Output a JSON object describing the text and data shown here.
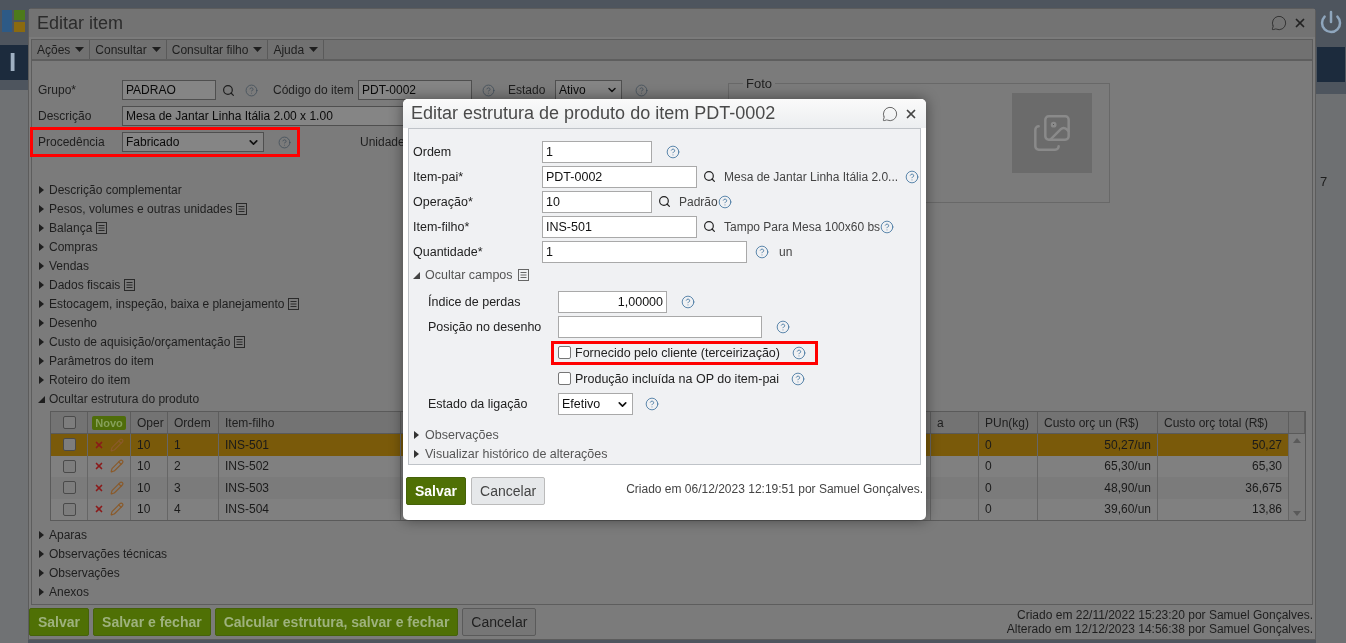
{
  "app_sidebar": {
    "title_fragment": "I"
  },
  "right_strip": {
    "count_fragment": "7"
  },
  "window": {
    "title": "Editar item"
  },
  "menu": [
    {
      "label": "Ações"
    },
    {
      "label": "Consultar"
    },
    {
      "label": "Consultar filho"
    },
    {
      "label": "Ajuda"
    }
  ],
  "form": {
    "grupo": {
      "label": "Grupo*",
      "value": "PADRAO"
    },
    "codigo": {
      "label": "Código do item",
      "value": "PDT-0002"
    },
    "estado": {
      "label": "Estado",
      "value": "Ativo"
    },
    "descricao": {
      "label": "Descrição",
      "value": "Mesa de Jantar Linha Itália 2.00 x 1.00"
    },
    "procedencia": {
      "label": "Procedência",
      "value": "Fabricado",
      "highlighted": true
    },
    "unidade": {
      "label": "Unidade"
    }
  },
  "foto": {
    "legend": "Foto"
  },
  "sections": [
    {
      "label": "Descrição complementar",
      "expanded": false,
      "note": false
    },
    {
      "label": "Pesos, volumes e outras unidades",
      "expanded": false,
      "note": true
    },
    {
      "label": "Balança",
      "expanded": false,
      "note": true
    },
    {
      "label": "Compras",
      "expanded": false,
      "note": false
    },
    {
      "label": "Vendas",
      "expanded": false,
      "note": false
    },
    {
      "label": "Dados fiscais",
      "expanded": false,
      "note": true
    },
    {
      "label": "Estocagem, inspeção, baixa e planejamento",
      "expanded": false,
      "note": true
    },
    {
      "label": "Desenho",
      "expanded": false,
      "note": false
    },
    {
      "label": "Custo de aquisição/orçamentação",
      "expanded": false,
      "note": true
    },
    {
      "label": "Parâmetros do item",
      "expanded": false,
      "note": false
    },
    {
      "label": "Roteiro do item",
      "expanded": false,
      "note": false
    },
    {
      "label": "Ocultar estrutura do produto",
      "expanded": true,
      "note": false
    }
  ],
  "structure_table": {
    "columns": [
      {
        "kind": "check",
        "checked": false
      },
      {
        "kind": "actions",
        "label": "Novo"
      },
      {
        "kind": "data",
        "label": "Oper"
      },
      {
        "kind": "data",
        "label": "Ordem"
      },
      {
        "kind": "data",
        "label": "Item-filho"
      },
      {
        "kind": "hidden"
      },
      {
        "kind": "blank",
        "label": "a"
      },
      {
        "kind": "data",
        "label": "PUn(kg)"
      },
      {
        "kind": "money",
        "label": "Custo orç un (R$)"
      },
      {
        "kind": "money",
        "label": "Custo orç total (R$)"
      }
    ],
    "rows": [
      {
        "selected": true,
        "checked": false,
        "cells": [
          "",
          "",
          "10",
          "1",
          "INS-501",
          "",
          "",
          "0",
          "50,27/un",
          "50,27"
        ]
      },
      {
        "selected": false,
        "checked": false,
        "cells": [
          "",
          "",
          "10",
          "2",
          "INS-502",
          "",
          "",
          "0",
          "65,30/un",
          "65,30"
        ]
      },
      {
        "selected": false,
        "checked": false,
        "cells": [
          "",
          "",
          "10",
          "3",
          "INS-503",
          "",
          "",
          "0",
          "48,90/un",
          "36,675"
        ]
      },
      {
        "selected": false,
        "checked": false,
        "cells": [
          "",
          "",
          "10",
          "4",
          "INS-504",
          "",
          "",
          "0",
          "39,60/un",
          "13,86"
        ]
      }
    ]
  },
  "sections_after": [
    {
      "label": "Aparas",
      "expanded": false
    },
    {
      "label": "Observações técnicas",
      "expanded": false
    },
    {
      "label": "Observações",
      "expanded": false
    },
    {
      "label": "Anexos",
      "expanded": false
    }
  ],
  "buttons": [
    {
      "label": "Salvar",
      "kind": "primary"
    },
    {
      "label": "Salvar e fechar",
      "kind": "primary"
    },
    {
      "label": "Calcular estrutura, salvar e fechar",
      "kind": "primary"
    },
    {
      "label": "Cancelar",
      "kind": "secondary"
    }
  ],
  "audit": [
    "Criado em 22/11/2022 15:23:20 por Samuel Gonçalves.",
    "Alterado em 12/12/2023 14:56:38 por Samuel Gonçalves."
  ],
  "dialog": {
    "title": "Editar estrutura de produto do item PDT-0002",
    "fields": [
      {
        "kind": "short",
        "label": "Ordem",
        "value": "1"
      },
      {
        "kind": "lookup",
        "label": "Item-pai*",
        "value": "PDT-0002",
        "description": "Mesa de Jantar Linha Itália 2.0..."
      },
      {
        "kind": "lookup_short",
        "label": "Operação*",
        "value": "10",
        "description": "Padrão"
      },
      {
        "kind": "lookup",
        "label": "Item-filho*",
        "value": "INS-501",
        "description": "Tampo Para Mesa 100x60 bs"
      },
      {
        "kind": "quantity",
        "label": "Quantidade*",
        "value": "1",
        "unit": "un"
      }
    ],
    "group": {
      "label": "Ocultar campos",
      "expanded": true,
      "fields": [
        {
          "kind": "decimal",
          "label": "Índice de perdas",
          "value": "1,00000"
        },
        {
          "kind": "wide",
          "label": "Posição no desenho"
        },
        {
          "kind": "checkbox",
          "label": "Fornecido pelo cliente (terceirização)",
          "checked": false,
          "highlighted": true
        },
        {
          "kind": "checkbox",
          "label": "Produção incluída na OP do item-pai",
          "checked": false,
          "highlighted": false
        },
        {
          "kind": "select",
          "label": "Estado da ligação",
          "value": "Efetivo"
        }
      ]
    },
    "sections": [
      {
        "label": "Observações",
        "expanded": false
      },
      {
        "label": "Visualizar histórico de alterações",
        "expanded": false
      }
    ],
    "buttons": [
      {
        "label": "Salvar",
        "kind": "primary"
      },
      {
        "label": "Cancelar",
        "kind": "secondary"
      }
    ],
    "created": "Criado em 06/12/2023 12:19:51 por Samuel Gonçalves."
  }
}
